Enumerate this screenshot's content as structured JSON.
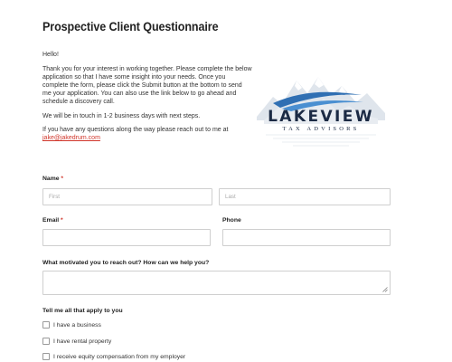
{
  "form": {
    "title": "Prospective Client Questionnaire",
    "intro": {
      "greeting": "Hello!",
      "p1": "Thank you for your interest in working together. Please complete the below application so that I have some insight into your needs. Once you complete the form, please click the Submit button at the bottom to send me your application. You can also use the link below to go ahead and schedule a discovery call.",
      "p2": "We will be in touch in 1-2 business days with next steps.",
      "p3_prefix": "If you have any questions along the way please reach out to me at ",
      "email_link": "jake@jakedrum.com"
    },
    "logo": {
      "name": "LAKEVIEW",
      "tagline": "TAX ADVISORS",
      "colors": {
        "navy": "#1b2a44",
        "blue": "#2f6fb3",
        "mountain": "#d6dde6"
      }
    },
    "name_field": {
      "label": "Name",
      "required_mark": "*",
      "first_placeholder": "First",
      "last_placeholder": "Last"
    },
    "email_field": {
      "label": "Email",
      "required_mark": "*"
    },
    "phone_field": {
      "label": "Phone"
    },
    "motivation_field": {
      "label": "What motivated you to reach out? How can we help you?"
    },
    "applies_group": {
      "label": "Tell me all that apply to you",
      "options": [
        "I have a business",
        "I have rental property",
        "I receive equity compensation from my employer"
      ]
    },
    "accent_color": "#d0352a"
  }
}
